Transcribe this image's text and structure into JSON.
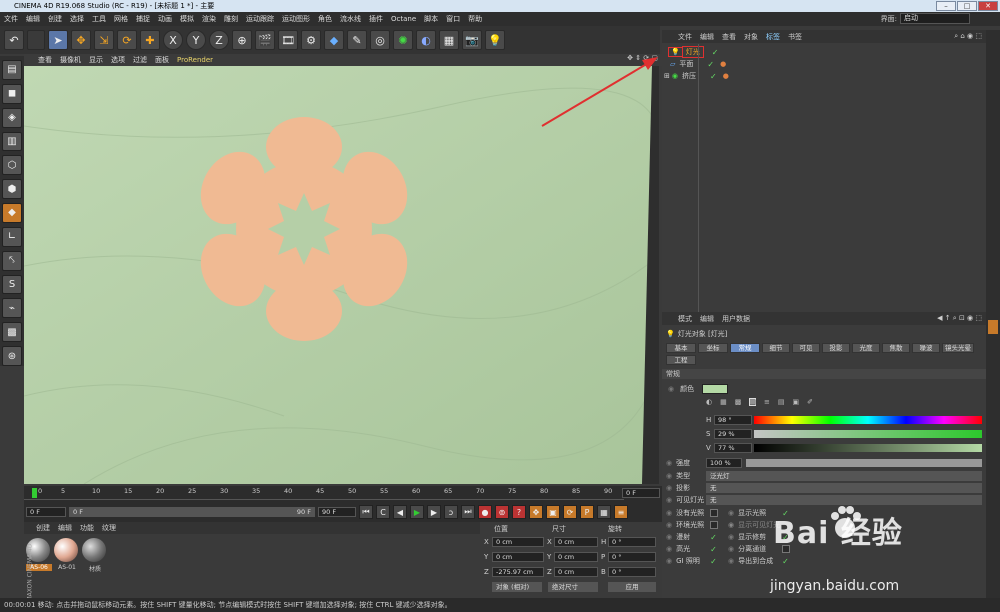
{
  "title": "CINEMA 4D R19.068 Studio (RC - R19) - [未标题 1 *] - 主要",
  "menu": [
    "文件",
    "编辑",
    "创建",
    "选择",
    "工具",
    "网格",
    "捕捉",
    "动画",
    "模拟",
    "渲染",
    "雕刻",
    "运动跟踪",
    "运动图形",
    "角色",
    "流水线",
    "插件",
    "Octane",
    "脚本",
    "窗口",
    "帮助"
  ],
  "interface_label": "界面:",
  "interface_value": "启动",
  "toolbar": {
    "undo": "↶",
    "move": "✥",
    "scale": "⇲",
    "rotate": "⟳",
    "x": "X",
    "y": "Y",
    "z": "Z"
  },
  "viewport_menu": [
    "查看",
    "摄像机",
    "显示",
    "选项",
    "过滤",
    "面板",
    "ProRender"
  ],
  "timeline": {
    "ticks": [
      "0",
      "5",
      "10",
      "15",
      "20",
      "25",
      "30",
      "35",
      "40",
      "45",
      "50",
      "55",
      "60",
      "65",
      "70",
      "75",
      "80",
      "85",
      "90"
    ],
    "frame_right": "0 F",
    "start": "0 F",
    "slider": "0 F",
    "end_field": "90 F",
    "max": "90 F"
  },
  "materials": {
    "menu": [
      "创建",
      "编辑",
      "功能",
      "纹理"
    ],
    "items": [
      "AS-06",
      "AS-01",
      "材质"
    ]
  },
  "coords": {
    "headers": [
      "位置",
      "尺寸",
      "旋转"
    ],
    "rows": [
      [
        "X",
        "0 cm",
        "X",
        "0 cm",
        "H",
        "0 °"
      ],
      [
        "Y",
        "0 cm",
        "Y",
        "0 cm",
        "P",
        "0 °"
      ],
      [
        "Z",
        "-275.97 cm",
        "Z",
        "0 cm",
        "B",
        "0 °"
      ]
    ],
    "mode": "对象 (相对)",
    "size_mode": "绝对尺寸",
    "apply": "应用"
  },
  "objects": {
    "menu": [
      "文件",
      "编辑",
      "查看",
      "对象",
      "标签",
      "书签"
    ],
    "items": [
      {
        "name": "灯光"
      },
      {
        "name": "平面"
      },
      {
        "name": "挤压"
      }
    ]
  },
  "attributes": {
    "menu": [
      "模式",
      "编辑",
      "用户数据"
    ],
    "object_title": "灯光对象 [灯光]",
    "tabs": [
      "基本",
      "坐标",
      "常规",
      "细节",
      "可见",
      "投影",
      "光度",
      "焦散",
      "噪波",
      "镜头光晕",
      "工程"
    ],
    "section": "常规",
    "color_label": "颜色",
    "color_hex": "#b4d9a5",
    "h_label": "H",
    "h": "98 °",
    "s_label": "S",
    "s": "29 %",
    "v_label": "V",
    "v": "77 %",
    "intensity_label": "强度",
    "intensity": "100 %",
    "type_label": "类型",
    "type": "泛光灯",
    "shadow_label": "投影",
    "shadow": "无",
    "visible_label": "可见灯光",
    "visible": "无",
    "checks_left": [
      "没有光照",
      "环境光照",
      "漫射",
      "高光",
      "GI 照明"
    ],
    "checks_right": [
      "显示光照",
      "显示可见灯光",
      "显示修剪",
      "分离通道",
      "导出到合成"
    ]
  },
  "status": "00:00:01  移动: 点击并拖动鼠标移动元素。按住 SHIFT 键量化移动; 节点编辑模式时按住 SHIFT 键增加选择对象; 按住 CTRL 键减少选择对象。",
  "watermark_brand": "Bai 经验",
  "watermark_url": "jingyan.baidu.com",
  "maxon": "MAXON CINEMA 4D",
  "colors": {
    "viewport": "#b5cfa7",
    "flower": "#f0ba93",
    "highlight": "#e03030"
  }
}
